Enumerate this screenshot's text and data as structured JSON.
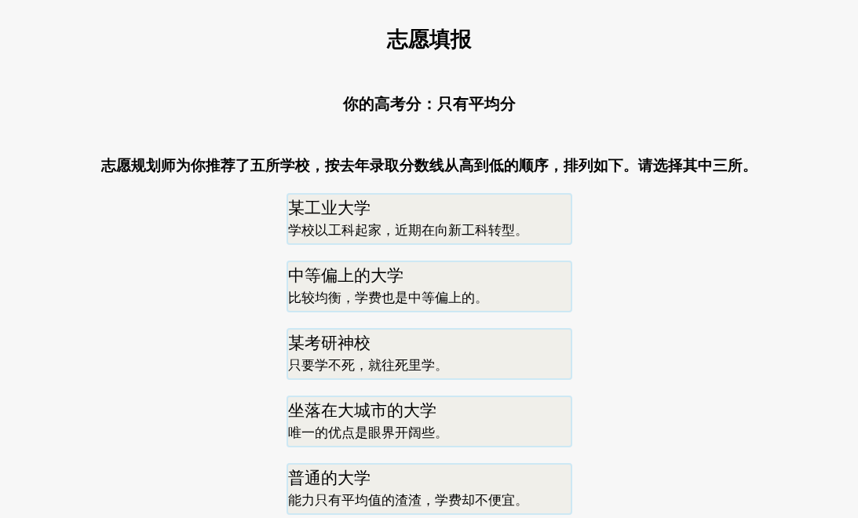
{
  "title": "志愿填报",
  "score": "你的高考分：只有平均分",
  "instruction": "志愿规划师为你推荐了五所学校，按去年录取分数线从高到低的顺序，排列如下。请选择其中三所。",
  "schools": [
    {
      "name": "某工业大学",
      "description": "学校以工科起家，近期在向新工科转型。",
      "selected": false
    },
    {
      "name": "中等偏上的大学",
      "description": "比较均衡，学费也是中等偏上的。",
      "selected": false
    },
    {
      "name": "某考研神校",
      "description": "只要学不死，就往死里学。",
      "selected": false
    },
    {
      "name": "坐落在大城市的大学",
      "description": "唯一的优点是眼界开阔些。",
      "selected": false
    },
    {
      "name": "普通的大学",
      "description": "能力只有平均值的渣渣，学费却不便宜。",
      "selected": false
    }
  ]
}
